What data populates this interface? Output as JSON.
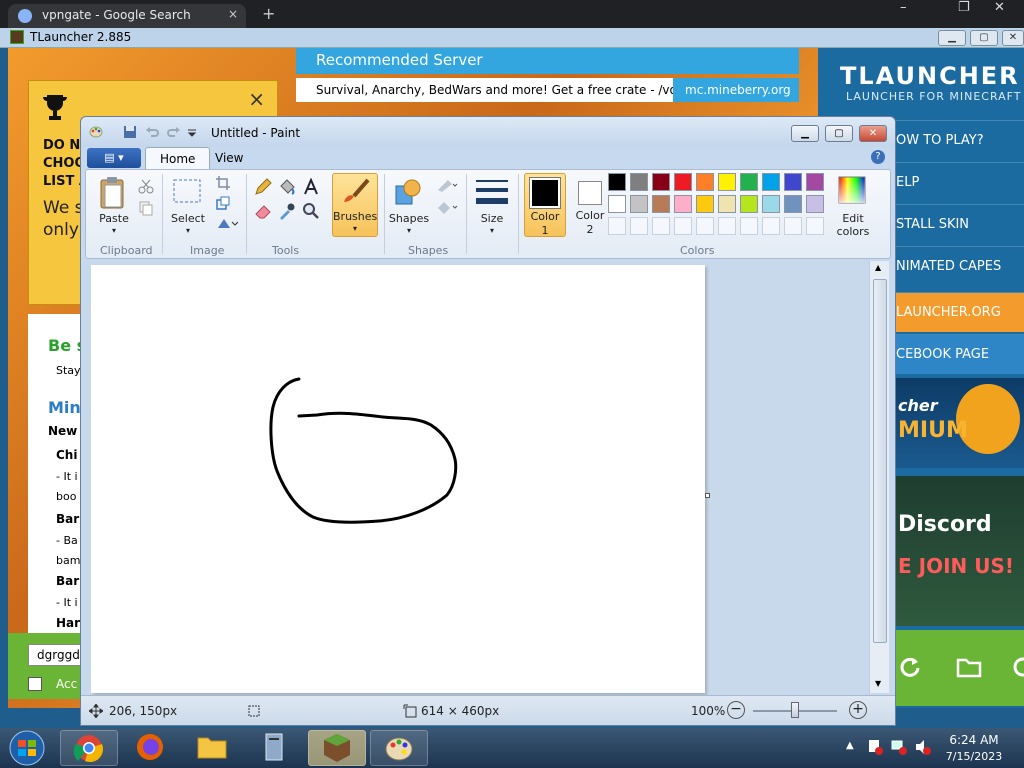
{
  "chrome": {
    "tab_title": "vpngate - Google Search",
    "tab_close": "×",
    "new_tab": "+",
    "min": "–",
    "restore": "❐",
    "close": "✕"
  },
  "tlauncher": {
    "title": "TLauncher 2.885",
    "banner_title": "Recommended Server",
    "banner_text": "Survival, Anarchy, BedWars and more! Get a free crate - /vote",
    "banner_site": "mc.mineberry.org",
    "notice_close": "×",
    "notice_lines": [
      "DO NO",
      "CHOO",
      "LIST A"
    ],
    "notice_body": [
      "We s",
      "only"
    ],
    "panel": {
      "be_s": "Be s",
      "stay": "Stay",
      "min": "Min",
      "new": "New",
      "chi": "Chi",
      "it1": "- It i",
      "boo": "boo",
      "bar1": "Bar",
      "ba": "- Ba",
      "bam": "bam",
      "bar2": "Bar",
      "it2": "- It i",
      "har": "Har"
    },
    "input_value": "dgrggdg",
    "check_label": "Acc",
    "logo_title": "TLAUNCHER",
    "logo_sub": "LAUNCHER FOR MINECRAFT",
    "menu": [
      "OW TO PLAY?",
      "ELP",
      "STALL SKIN",
      "NIMATED CAPES",
      "LAUNCHER.ORG",
      "CEBOOK PAGE"
    ],
    "promo1": {
      "line1": "cher",
      "line2": "MIUM"
    },
    "promo2": {
      "line1": "Discord",
      "line2": "E JOIN US!"
    },
    "accent": "#f39b2d"
  },
  "paint": {
    "title": "Untitled - Paint",
    "tabs": {
      "home": "Home",
      "view": "View"
    },
    "groups": {
      "clipboard": "Clipboard",
      "image": "Image",
      "tools": "Tools",
      "shapes": "Shapes",
      "colors": "Colors"
    },
    "buttons": {
      "paste": "Paste",
      "select": "Select",
      "brushes": "Brushes",
      "shapes": "Shapes",
      "size": "Size",
      "color1": "Color",
      "color1_num": "1",
      "color2": "Color",
      "color2_num": "2",
      "edit_colors_1": "Edit",
      "edit_colors_2": "colors"
    },
    "palette_row1": [
      "#000000",
      "#7f7f7f",
      "#880015",
      "#ed1c24",
      "#ff7f27",
      "#fff200",
      "#22b14c",
      "#00a2e8",
      "#3f48cc",
      "#a349a4"
    ],
    "palette_row2": [
      "#ffffff",
      "#c3c3c3",
      "#b97a57",
      "#ffaec9",
      "#ffc90e",
      "#efe4b0",
      "#b5e61d",
      "#99d9ea",
      "#7092be",
      "#c8bfe7"
    ],
    "status": {
      "cursor": "206, 150px",
      "size": "614 × 460px",
      "zoom": "100%"
    }
  },
  "taskbar": {
    "time": "6:24 AM",
    "date": "7/15/2023"
  }
}
